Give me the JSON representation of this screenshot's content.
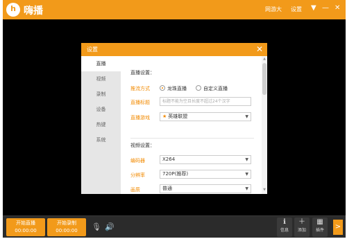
{
  "app": {
    "title": "嗨播",
    "logo_letter": "h",
    "links": [
      "网游大",
      "设置"
    ],
    "controls": [
      "▼",
      "—",
      "✕"
    ]
  },
  "dialog": {
    "title": "设置",
    "close": "✕",
    "sidebar": [
      "直播",
      "视频",
      "录制",
      "设备",
      "热键",
      "系统"
    ],
    "live": {
      "section_title": "直播设置：",
      "push_label": "推流方式",
      "push_options": [
        "龙珠直播",
        "自定义直播"
      ],
      "push_selected": 0,
      "live_title_label": "直播标题",
      "live_title_placeholder": "标题不能为空且长度不超过24个汉字",
      "game_label": "直播游戏",
      "game_value": "英雄联盟"
    },
    "video": {
      "section_title": "视频设置：",
      "encoder_label": "编码器",
      "encoder_value": "X264",
      "resolution_label": "分辨率",
      "resolution_value": "720P(推荐)",
      "quality_label": "画质",
      "quality_value": "普通"
    }
  },
  "bottom": {
    "live_btn": {
      "label": "开始直播",
      "time": "00:00:00"
    },
    "rec_btn": {
      "label": "开始录制",
      "time": "00:00:00"
    },
    "tools": [
      {
        "icon": "info-icon",
        "label": "信息"
      },
      {
        "icon": "add-icon",
        "label": "添加"
      },
      {
        "icon": "plugin-icon",
        "label": "插件"
      }
    ],
    "expand": ">"
  },
  "colors": {
    "accent": "#f29a1a",
    "label": "#f28a00",
    "bg": "#000000"
  }
}
